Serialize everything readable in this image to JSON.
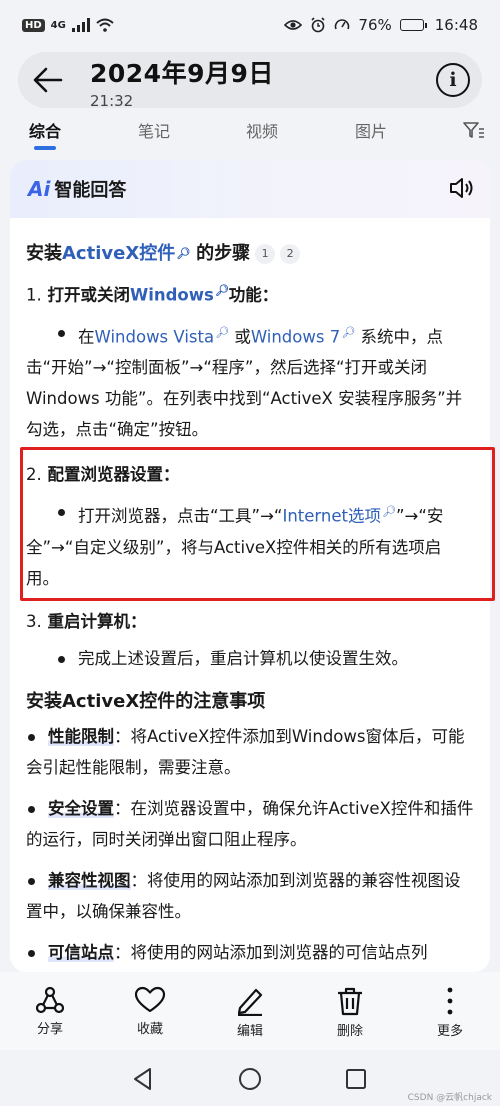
{
  "status_bar": {
    "network": "4G",
    "battery_pct": "76%",
    "time": "16:48",
    "battery_level": 0.76
  },
  "header": {
    "title": "2024年9月9日",
    "subtitle": "21:32"
  },
  "tabs": [
    {
      "label": "综合",
      "active": true
    },
    {
      "label": "笔记",
      "active": false
    },
    {
      "label": "视频",
      "active": false
    },
    {
      "label": "图片",
      "active": false
    }
  ],
  "card": {
    "logo": "Ai",
    "title": "智能回答",
    "heading_prefix": "安装",
    "heading_link": "ActiveX控件",
    "heading_suffix": "的步骤",
    "citations": [
      "1",
      "2"
    ],
    "steps": [
      {
        "number": "1.",
        "title_a": "打开或关闭",
        "title_link": "Windows",
        "title_b": "功能：",
        "body_a": "在",
        "body_link1": "Windows Vista",
        "body_b": "或",
        "body_link2": "Windows 7",
        "body_c": "系统中，点击“开始”→“控制面板”→“程序”，然后选择“打开或关闭 Windows 功能”。在列表中找到“ActiveX 安装程序服务”并勾选，点击“确定”按钮。"
      },
      {
        "number": "2.",
        "title": "配置浏览器设置：",
        "body_a": "打开浏览器，点击“工具”→“",
        "body_link": "Internet选项",
        "body_b": "”→“安全”→“自定义级别”，将与ActiveX控件相关的所有选项启用。"
      },
      {
        "number": "3.",
        "title": "重启计算机：",
        "body": "完成上述设置后，重启计算机以使设置生效。"
      }
    ],
    "notes_heading": "安装ActiveX控件的注意事项",
    "notes": [
      {
        "label": "性能限制",
        "text": "：将ActiveX控件添加到Windows窗体后，可能会引起性能限制，需要注意。"
      },
      {
        "label": "安全设置",
        "text": "：在浏览器设置中，确保允许ActiveX控件和插件的运行，同时关闭弹出窗口阻止程序。"
      },
      {
        "label": "兼容性视图",
        "text": "：将使用的网站添加到浏览器的兼容性视图设置中，以确保兼容性。"
      },
      {
        "label": "可信站点",
        "text": "：将使用的网站添加到浏览器的可信站点列"
      }
    ]
  },
  "actions": [
    {
      "label": "分享",
      "icon": "share-icon"
    },
    {
      "label": "收藏",
      "icon": "heart-icon"
    },
    {
      "label": "编辑",
      "icon": "pen-icon"
    },
    {
      "label": "删除",
      "icon": "trash-icon"
    },
    {
      "label": "更多",
      "icon": "more-icon"
    }
  ],
  "watermark": "CSDN @云帆chjack",
  "colors": {
    "accent": "#2e6fe0",
    "link": "#2f5fb8",
    "highlight_box": "#e0201e"
  }
}
